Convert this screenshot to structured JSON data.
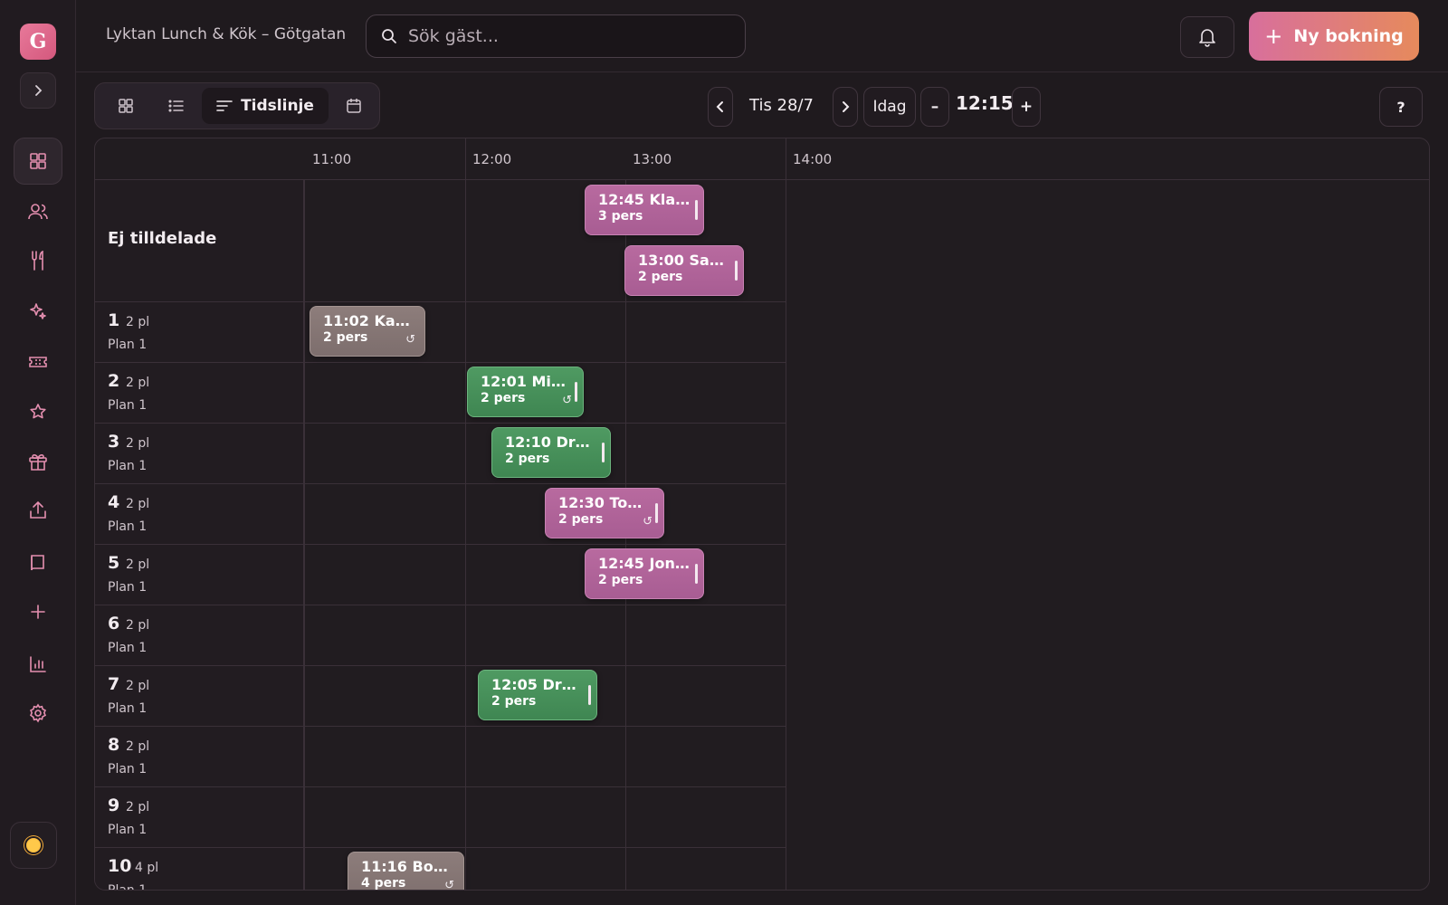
{
  "app": {
    "logo_letter": "G",
    "venue": "Lyktan Lunch & Kök – Götgatan"
  },
  "search": {
    "placeholder": "Sök gäst..."
  },
  "header": {
    "new_booking": "Ny bokning"
  },
  "views": {
    "active_label": "Tidslinje"
  },
  "datenav": {
    "date": "Tis 28/7",
    "today": "Idag",
    "time": "12:15",
    "minus": "–",
    "plus": "+",
    "help": "?"
  },
  "timeline": {
    "hours": [
      "11:00",
      "12:00",
      "13:00",
      "14:00"
    ],
    "unassigned_label": "Ej tilldelade",
    "tables": [
      {
        "num": "1",
        "cap": "2 pl",
        "plan": "Plan 1"
      },
      {
        "num": "2",
        "cap": "2 pl",
        "plan": "Plan 1"
      },
      {
        "num": "3",
        "cap": "2 pl",
        "plan": "Plan 1"
      },
      {
        "num": "4",
        "cap": "2 pl",
        "plan": "Plan 1"
      },
      {
        "num": "5",
        "cap": "2 pl",
        "plan": "Plan 1"
      },
      {
        "num": "6",
        "cap": "2 pl",
        "plan": "Plan 1"
      },
      {
        "num": "7",
        "cap": "2 pl",
        "plan": "Plan 1"
      },
      {
        "num": "8",
        "cap": "2 pl",
        "plan": "Plan 1"
      },
      {
        "num": "9",
        "cap": "2 pl",
        "plan": "Plan 1"
      },
      {
        "num": "10",
        "cap": "4 pl",
        "plan": "Plan 1"
      }
    ],
    "bookings": [
      {
        "title": "12:45  Klar...",
        "guests": "3 pers",
        "color": "pink"
      },
      {
        "title": "13:00  Sam...",
        "guests": "2 pers",
        "color": "pink"
      },
      {
        "title": "11:02  Kari...",
        "guests": "2 pers",
        "color": "grey"
      },
      {
        "title": "12:01  Mia ...",
        "guests": "2 pers",
        "color": "green"
      },
      {
        "title": "12:10  Drop...",
        "guests": "2 pers",
        "color": "green"
      },
      {
        "title": "12:30  Tove...",
        "guests": "2 pers",
        "color": "pink"
      },
      {
        "title": "12:45  Jon...",
        "guests": "2 pers",
        "color": "pink"
      },
      {
        "title": "12:05  Drop...",
        "guests": "2 pers",
        "color": "green"
      },
      {
        "title": "11:16  Bo ...",
        "guests": "4 pers",
        "color": "grey"
      }
    ]
  }
}
